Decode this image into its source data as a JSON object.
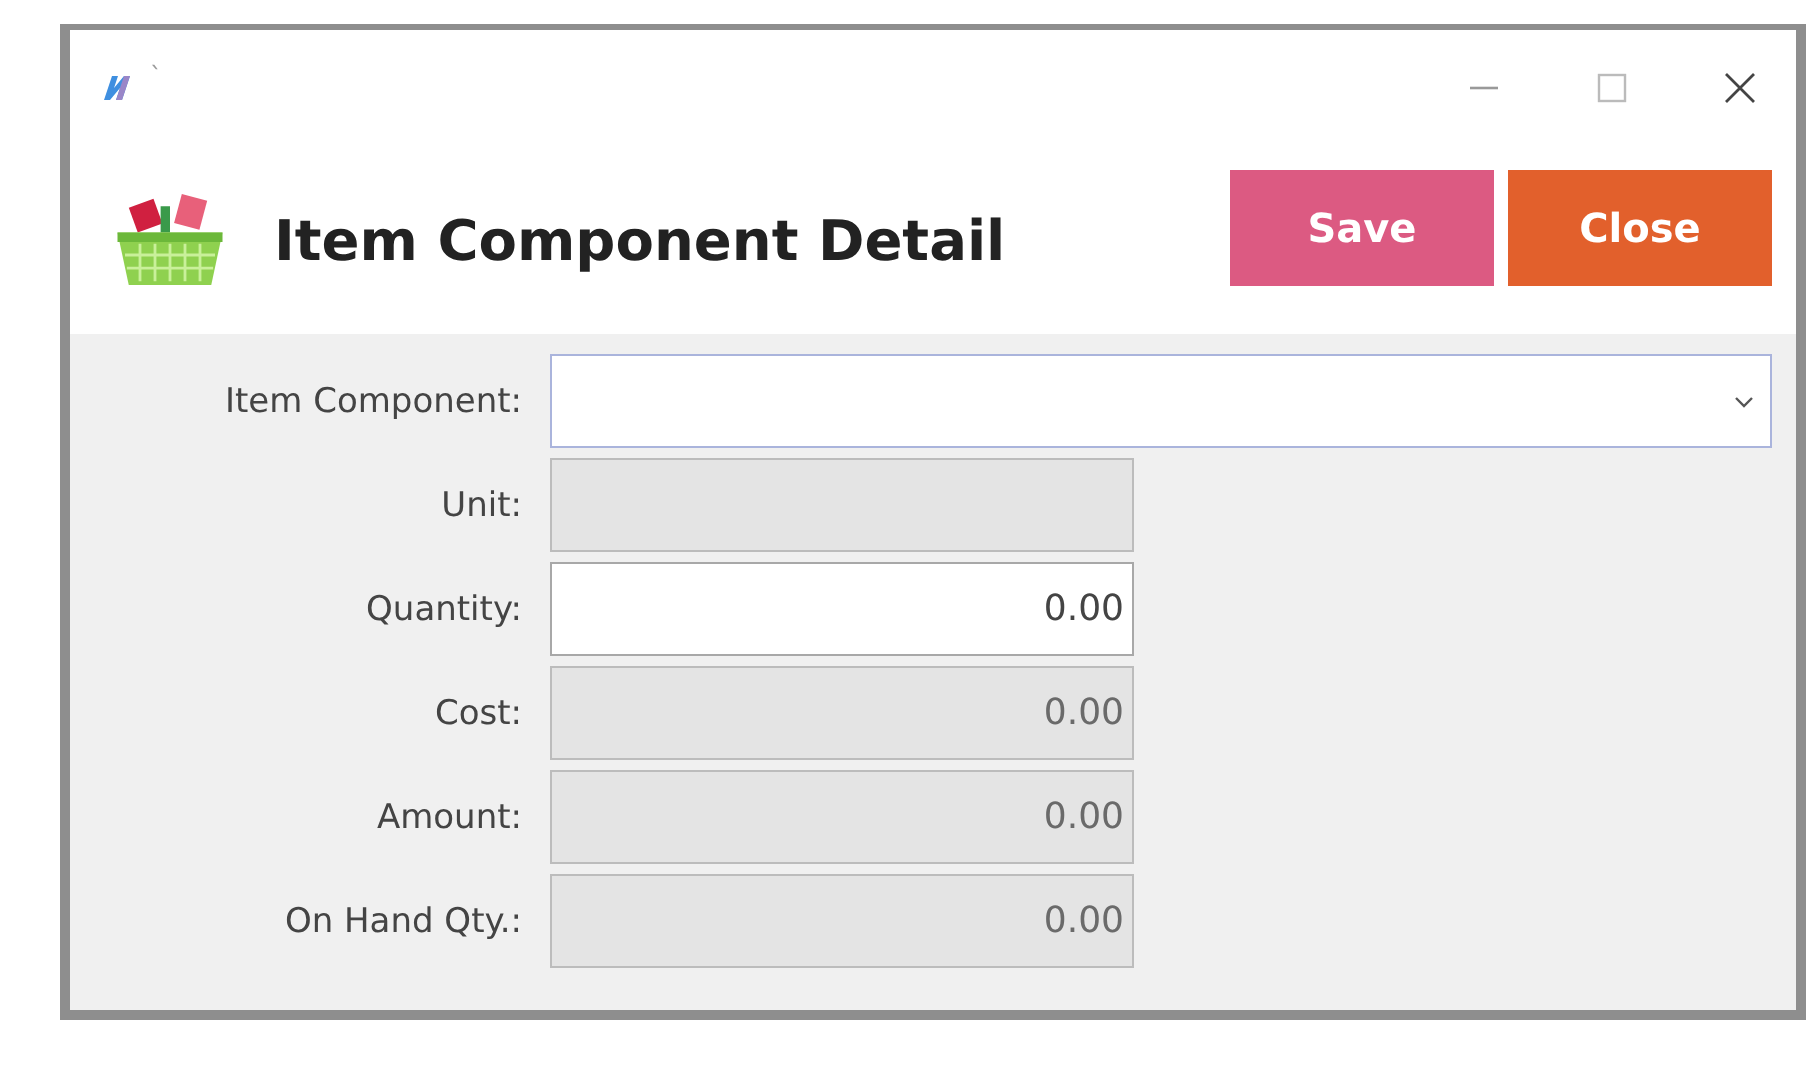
{
  "window": {
    "title_glyph": "`"
  },
  "header": {
    "title": "Item Component Detail",
    "buttons": [
      {
        "label": "Save",
        "color": "#dc5a82"
      },
      {
        "label": "Close",
        "color": "#e2602c"
      }
    ]
  },
  "fields": [
    {
      "label": "Item Component:",
      "kind": "combo",
      "disabled": false,
      "focused": true
    },
    {
      "label": "Unit:",
      "kind": "text",
      "disabled": true,
      "focused": false
    },
    {
      "label": "Quantity:",
      "kind": "text",
      "value": "0.00",
      "disabled": false,
      "focused": false
    },
    {
      "label": "Cost:",
      "kind": "text",
      "value": "0.00",
      "disabled": true,
      "focused": false
    },
    {
      "label": "Amount:",
      "kind": "text",
      "value": "0.00",
      "disabled": true,
      "focused": false
    },
    {
      "label": "On Hand Qty.:",
      "kind": "text",
      "value": "0.00",
      "disabled": true,
      "focused": false
    }
  ]
}
